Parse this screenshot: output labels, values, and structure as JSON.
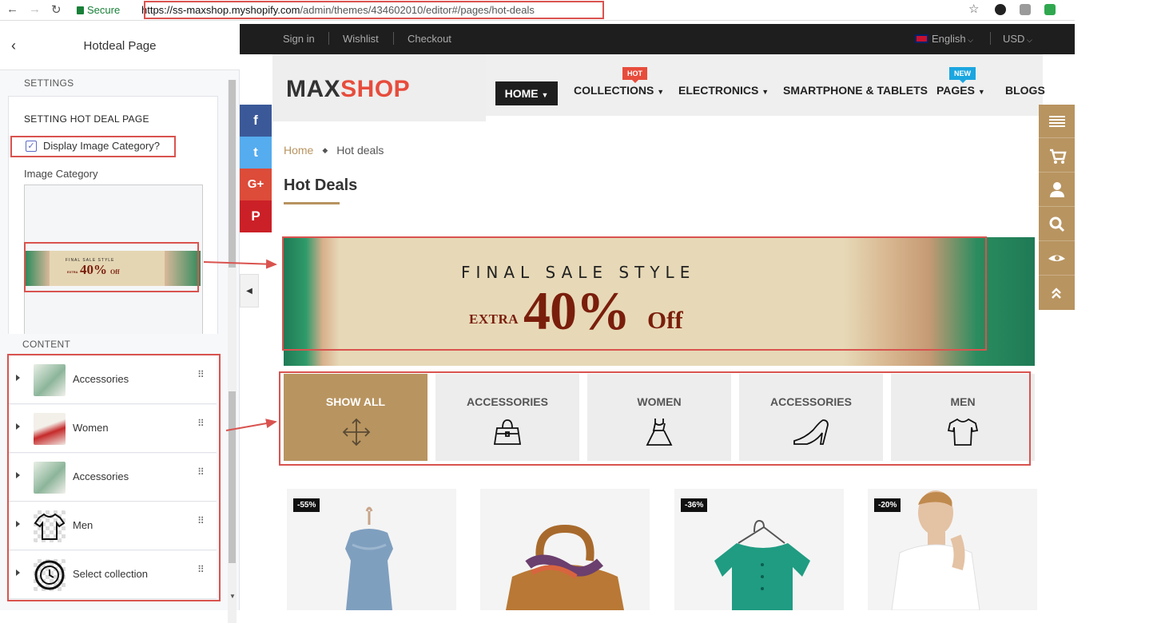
{
  "browser": {
    "secure_label": "Secure",
    "url_host": "https://ss-maxshop.myshopify.com",
    "url_path": "/admin/themes/434602010/editor#/pages/hot-deals"
  },
  "editor": {
    "panel_title": "Hotdeal Page",
    "settings_section": "SETTINGS",
    "settings_heading": "SETTING HOT DEAL PAGE",
    "display_image_category_label": "Display Image Category?",
    "display_image_category_checked": true,
    "image_category_label": "Image Category",
    "content_section": "CONTENT",
    "content_items": [
      {
        "label": "Accessories",
        "thumb": "accessories-thumb"
      },
      {
        "label": "Women",
        "thumb": "women-thumb"
      },
      {
        "label": "Accessories",
        "thumb": "accessories-thumb"
      },
      {
        "label": "Men",
        "thumb": "tshirt-thumb"
      },
      {
        "label": "Select collection",
        "thumb": "watch-thumb"
      }
    ]
  },
  "store": {
    "topbar": {
      "sign_in": "Sign in",
      "wishlist": "Wishlist",
      "checkout": "Checkout",
      "language": "English",
      "currency": "USD"
    },
    "logo": {
      "part1": "MAX",
      "part2": "SHOP"
    },
    "nav": {
      "home": "HOME",
      "collections": "COLLECTIONS",
      "electronics": "ELECTRONICS",
      "smartphone": "SMARTPHONE & TABLETS",
      "pages": "PAGES",
      "blogs": "BLOGS",
      "hot_badge": "HOT",
      "new_badge": "NEW"
    },
    "social": [
      "f",
      "t",
      "G+",
      "P"
    ],
    "breadcrumb": {
      "home": "Home",
      "current": "Hot deals"
    },
    "page_title": "Hot Deals",
    "banner": {
      "headline": "FINAL SALE STYLE",
      "extra": "EXTRA",
      "percent": "40%",
      "off": "Off"
    },
    "category_tiles": [
      {
        "label": "SHOW ALL",
        "icon": "move-arrows-icon",
        "active": true
      },
      {
        "label": "ACCESSORIES",
        "icon": "handbag-icon",
        "active": false
      },
      {
        "label": "WOMEN",
        "icon": "dress-icon",
        "active": false
      },
      {
        "label": "ACCESSORIES",
        "icon": "high-heel-icon",
        "active": false
      },
      {
        "label": "MEN",
        "icon": "tshirt-icon",
        "active": false
      }
    ],
    "products": [
      {
        "discount": "-55%",
        "image": "denim-dress"
      },
      {
        "discount": "",
        "image": "leather-bag"
      },
      {
        "discount": "-36%",
        "image": "green-shirt"
      },
      {
        "discount": "-20%",
        "image": "man-white-tee"
      }
    ],
    "right_toolbar": [
      "menu-icon",
      "cart-icon",
      "user-icon",
      "search-icon",
      "eye-icon",
      "chevrons-up-icon"
    ],
    "colors": {
      "accent": "#b89460",
      "dark": "#1e1e1e",
      "hot": "#e74c3c",
      "new": "#1ba6e0",
      "annotation": "#d9534f"
    }
  }
}
